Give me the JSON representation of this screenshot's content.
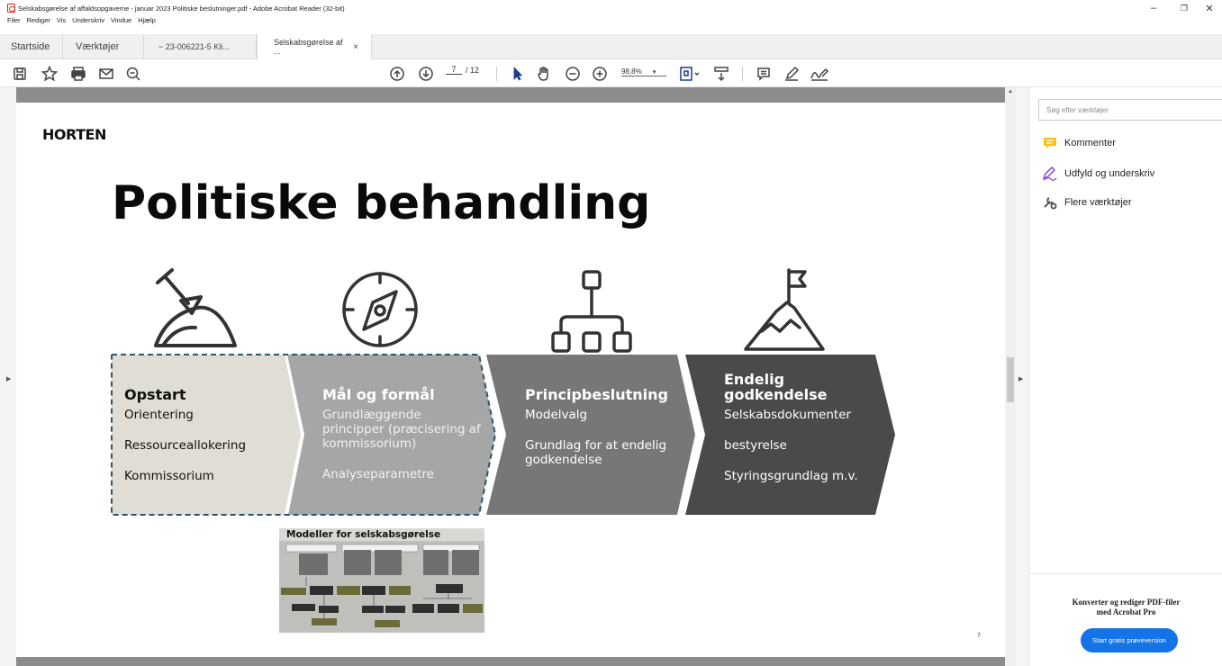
{
  "window": {
    "title": "Selskabsgørelse af affaldsopgaverne - januar 2023 Politiske beslutninger.pdf - Adobe Acrobat Reader (32-bit)",
    "minimize": "–",
    "maximize": "❐",
    "close": "✕"
  },
  "menu": [
    "Filer",
    "Rediger",
    "Vis",
    "Underskriv",
    "Vindue",
    "Hjælp"
  ],
  "tabs": [
    {
      "label": "Startside"
    },
    {
      "label": "Værktøjer"
    },
    {
      "label": "~ 23-006221-5 Kli..."
    },
    {
      "label": "Selskabsgørelse af ...",
      "close": "×"
    }
  ],
  "toolbar": {
    "current_page": "7",
    "total_pages": "/ 12",
    "zoom": "98,8%",
    "zoom_caret": "▾"
  },
  "slide": {
    "logo": "HORTEN",
    "title": "Politiske behandling",
    "page_number": "7",
    "steps": [
      {
        "heading": [
          "Opstart"
        ],
        "lines": [
          "Orientering",
          "Ressourceallokering",
          "Kommissorium"
        ]
      },
      {
        "heading": [
          "Mål og formål"
        ],
        "lines": [
          "Grundlæggende",
          "principper (præcisering af",
          "kommissorium)",
          "Analyseparametre"
        ]
      },
      {
        "heading": [
          "Principbeslutning"
        ],
        "lines": [
          "Modelvalg",
          "Grundlag for at endelig",
          "godkendelse"
        ]
      },
      {
        "heading": [
          "Endelig",
          "godkendelse"
        ],
        "lines": [
          "Selskabsdokumenter",
          "bestyrelse",
          "Styringsgrundlag m.v."
        ]
      }
    ],
    "models_title": "Modeller for selskabsgørelse"
  },
  "right_panel": {
    "search_placeholder": "Søg efter værktøjer",
    "tools": [
      {
        "label": "Kommenter",
        "icon": "comment-icon"
      },
      {
        "label": "Udfyld og underskriv",
        "icon": "sign-icon"
      },
      {
        "label": "Flere værktøjer",
        "icon": "more-tools-icon"
      }
    ],
    "promo_line1": "Konverter og rediger PDF-filer",
    "promo_line2": "med Acrobat Pro",
    "trial_button": "Start gratis prøveversion"
  },
  "colors": {
    "step1": "#e0ded4",
    "step2": "#a6a6a6",
    "step3": "#777777",
    "step4": "#4a4a4a",
    "dashed_border": "#2b5670",
    "accent_blue": "#1473e6",
    "comment_yellow": "#f5c11a",
    "sign_purple": "#8b5cc7"
  }
}
